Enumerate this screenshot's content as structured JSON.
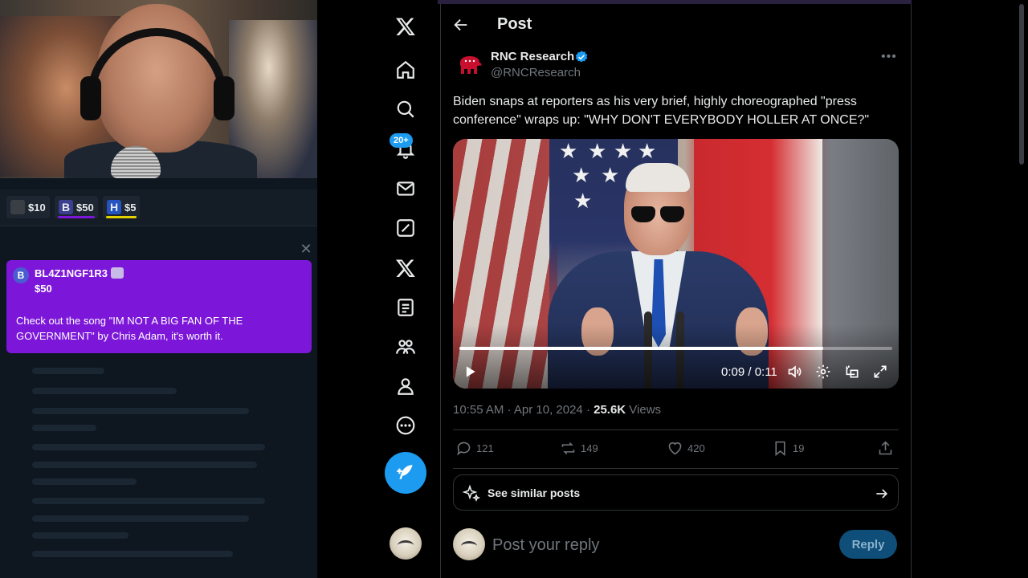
{
  "stream": {
    "donors": [
      {
        "label": "$10",
        "avatar": "",
        "avatar_color": "#3a3f46",
        "underline": ""
      },
      {
        "label": "$50",
        "avatar": "B",
        "avatar_color": "#3b3f8f",
        "underline": "#7c17d9"
      },
      {
        "label": "$5",
        "avatar": "H",
        "avatar_color": "#2452c0",
        "underline": "#e3d200"
      }
    ],
    "super_chat": {
      "badge": "B",
      "username": "BL4Z1NGF1R3",
      "amount": "$50",
      "message": "Check out the song \"IM NOT A BIG FAN OF THE GOVERNMENT\" by Chris Adam, it's worth it.",
      "color": "#7c17d9"
    }
  },
  "x": {
    "nav": {
      "notifications_badge": "20+",
      "items": [
        "x-logo-icon",
        "home-icon",
        "search-icon",
        "bell-icon",
        "mail-icon",
        "grok-icon",
        "x-premium-icon",
        "lists-icon",
        "communities-icon",
        "profile-icon",
        "more-icon"
      ]
    },
    "header": {
      "title": "Post"
    },
    "post": {
      "author_name": "RNC Research",
      "author_handle": "@RNCResearch",
      "text": "Biden snaps at reporters as his very brief, highly choreographed \"press conference\" wraps up: \"WHY DON'T EVERYBODY HOLLER AT ONCE?\"",
      "video": {
        "time": "0:09 / 0:11",
        "progress": 0.84
      },
      "timestamp": "10:55 AM · Apr 10, 2024 · ",
      "views_count": "25.6K",
      "views_label": " Views",
      "stats": {
        "replies": "121",
        "reposts": "149",
        "likes": "420",
        "bookmarks": "19"
      }
    },
    "similar": {
      "label": "See similar posts"
    },
    "reply": {
      "placeholder": "Post your reply",
      "button": "Reply"
    },
    "colors": {
      "accent": "#1d9bf0",
      "background": "#000000",
      "text": "#e7e9ea",
      "muted": "#71767b"
    }
  }
}
